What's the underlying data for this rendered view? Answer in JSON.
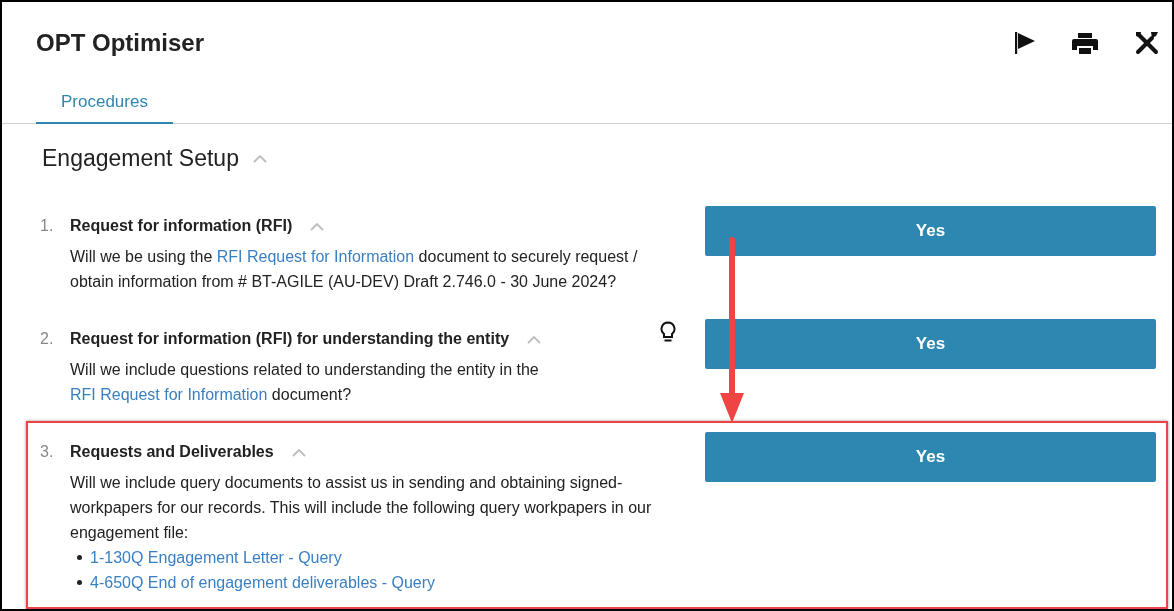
{
  "window": {
    "title": "OPT Optimiser"
  },
  "tabs": [
    {
      "label": "Procedures",
      "selected": true
    }
  ],
  "section": {
    "title": "Engagement Setup",
    "expanded": true
  },
  "items": [
    {
      "number": "1.",
      "title": "Request for information (RFI)",
      "expanded": true,
      "hint": false,
      "highlighted": false,
      "description": [
        {
          "text": "Will we be using the ",
          "link": false
        },
        {
          "text": "RFI Request for Information",
          "link": true
        },
        {
          "text": " document to securely request / obtain information from # BT-AGILE (AU-DEV) Draft 2.746.0 - 30 June 2024?",
          "link": false
        }
      ],
      "answer": "Yes"
    },
    {
      "number": "2.",
      "title": "Request for information (RFI) for understanding the entity",
      "expanded": true,
      "hint": true,
      "highlighted": false,
      "description": [
        {
          "text": "Will we include questions related to understanding the entity in the ",
          "link": false
        },
        {
          "text": "RFI Request for Information",
          "link": true
        },
        {
          "text": " document?",
          "link": false
        }
      ],
      "answer": "Yes"
    },
    {
      "number": "3.",
      "title": "Requests and Deliverables",
      "expanded": true,
      "hint": false,
      "highlighted": true,
      "description": [
        {
          "text": "Will we include query documents to assist us in sending and obtaining signed-workpapers for our records. This will include the following query workpapers in our engagement file:",
          "link": false
        }
      ],
      "bullets": [
        "1-130Q Engagement Letter - Query",
        "4-650Q End of engagement deliverables - Query"
      ],
      "answer": "Yes"
    }
  ]
}
